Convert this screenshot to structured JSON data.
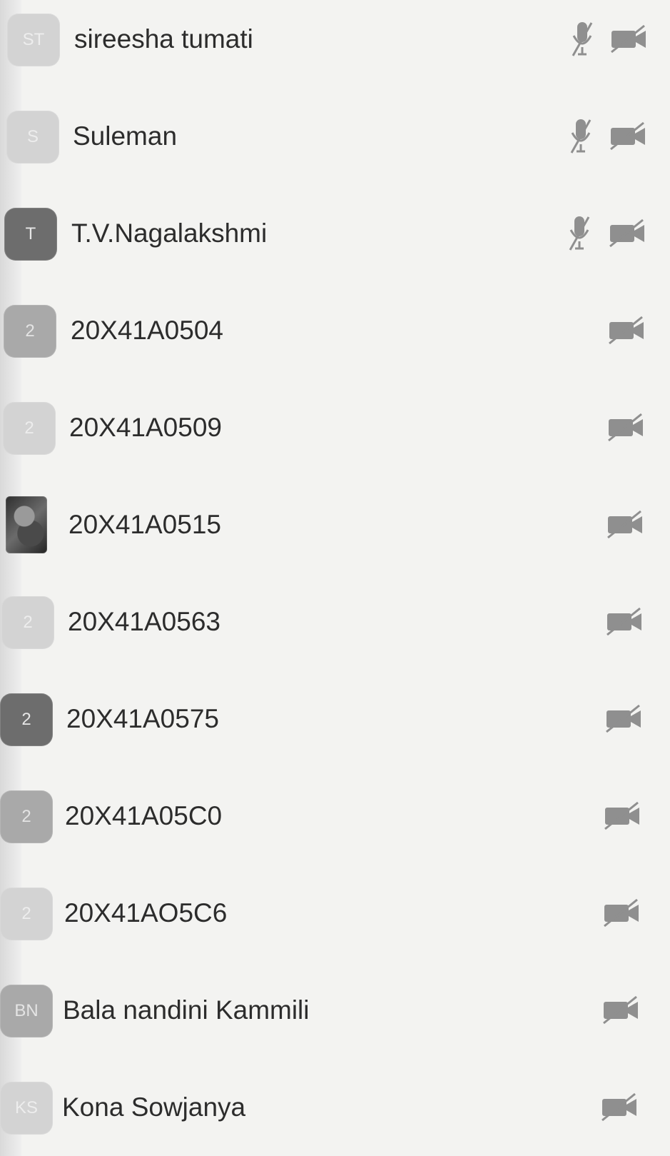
{
  "participants": [
    {
      "initials": "ST",
      "name": "sireesha tumati",
      "mic_icon": "mic-muted-icon",
      "cam_icon": "camera-off-icon"
    },
    {
      "initials": "S",
      "name": "Suleman",
      "mic_icon": "mic-muted-icon",
      "cam_icon": "camera-off-icon"
    },
    {
      "initials": "T",
      "name": "T.V.Nagalakshmi",
      "mic_icon": "mic-muted-icon",
      "cam_icon": "camera-off-icon"
    },
    {
      "initials": "2",
      "name": "20X41A0504",
      "cam_icon": "camera-off-icon"
    },
    {
      "initials": "2",
      "name": "20X41A0509",
      "cam_icon": "camera-off-icon"
    },
    {
      "initials": "",
      "name": "20X41A0515",
      "cam_icon": "camera-off-icon"
    },
    {
      "initials": "2",
      "name": "20X41A0563",
      "cam_icon": "camera-off-icon"
    },
    {
      "initials": "2",
      "name": "20X41A0575",
      "cam_icon": "camera-off-icon"
    },
    {
      "initials": "2",
      "name": "20X41A05C0",
      "cam_icon": "camera-off-icon"
    },
    {
      "initials": "2",
      "name": "20X41AO5C6",
      "cam_icon": "camera-off-icon"
    },
    {
      "initials": "BN",
      "name": "Bala nandini Kammili",
      "cam_icon": "camera-off-icon"
    },
    {
      "initials": "KS",
      "name": "Kona Sowjanya",
      "cam_icon": "camera-off-icon"
    }
  ],
  "colors": {
    "background": "#f3f3f1",
    "text": "#2c2c2c",
    "icon": "#8f8f8f"
  }
}
